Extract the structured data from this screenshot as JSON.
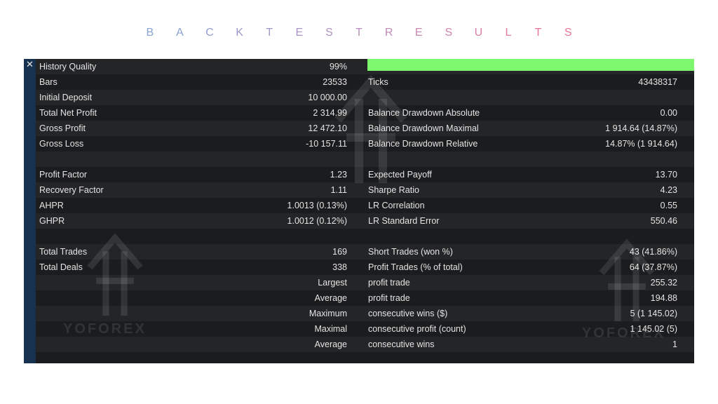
{
  "heading": {
    "letters": [
      {
        "ch": "B",
        "color": "#8aa3d4"
      },
      {
        "ch": "A",
        "color": "#8fa0d2"
      },
      {
        "ch": "C",
        "color": "#959dcf"
      },
      {
        "ch": "K",
        "color": "#9b9acb"
      },
      {
        "ch": "T",
        "color": "#a297c7"
      },
      {
        "ch": "E",
        "color": "#a994c3"
      },
      {
        "ch": "S",
        "color": "#b091bf"
      },
      {
        "ch": "T",
        "color": "#b88ebb"
      },
      {
        "ch": "R",
        "color": "#c08ab7"
      },
      {
        "ch": "E",
        "color": "#c887b2"
      },
      {
        "ch": "S",
        "color": "#cf83ac"
      },
      {
        "ch": "U",
        "color": "#d67fa6"
      },
      {
        "ch": "L",
        "color": "#dd7ba0"
      },
      {
        "ch": "T",
        "color": "#e3779a"
      },
      {
        "ch": "S",
        "color": "#e87394"
      }
    ]
  },
  "colors": {
    "panel_bg": "#1e1f21",
    "sidebar": "#16324f",
    "quality_bar": "#7ef86f",
    "text": "#e4e4e4"
  },
  "history_quality_fraction": 0.99,
  "rows": [
    {
      "lk": "History Quality",
      "lv": "99%",
      "rk": "",
      "rv": "",
      "bar": true
    },
    {
      "lk": "Bars",
      "lv": "23533",
      "rk": "Ticks",
      "rv": "43438317"
    },
    {
      "lk": "Initial Deposit",
      "lv": "10 000.00",
      "rk": "",
      "rv": ""
    },
    {
      "lk": "Total Net Profit",
      "lv": "2 314.99",
      "rk": "Balance Drawdown Absolute",
      "rv": "0.00"
    },
    {
      "lk": "Gross Profit",
      "lv": "12 472.10",
      "rk": "Balance Drawdown Maximal",
      "rv": "1 914.64 (14.87%)"
    },
    {
      "lk": "Gross Loss",
      "lv": "-10 157.11",
      "rk": "Balance Drawdown Relative",
      "rv": "14.87% (1 914.64)"
    },
    {
      "lk": "",
      "lv": "",
      "rk": "",
      "rv": ""
    },
    {
      "lk": "Profit Factor",
      "lv": "1.23",
      "rk": "Expected Payoff",
      "rv": "13.70"
    },
    {
      "lk": "Recovery Factor",
      "lv": "1.11",
      "rk": "Sharpe Ratio",
      "rv": "4.23"
    },
    {
      "lk": "AHPR",
      "lv": "1.0013 (0.13%)",
      "rk": "LR Correlation",
      "rv": "0.55"
    },
    {
      "lk": "GHPR",
      "lv": "1.0012 (0.12%)",
      "rk": "LR Standard Error",
      "rv": "550.46"
    },
    {
      "lk": "",
      "lv": "",
      "rk": "",
      "rv": ""
    },
    {
      "lk": "Total Trades",
      "lv": "169",
      "rk": "Short Trades (won %)",
      "rv": "43 (41.86%)"
    },
    {
      "lk": "Total Deals",
      "lv": "338",
      "rk": "Profit Trades (% of total)",
      "rv": "64 (37.87%)"
    },
    {
      "lk": "Largest",
      "lv": "",
      "rk": "profit trade",
      "rv": "255.32",
      "right": true
    },
    {
      "lk": "Average",
      "lv": "",
      "rk": "profit trade",
      "rv": "194.88",
      "right": true
    },
    {
      "lk": "Maximum",
      "lv": "",
      "rk": "consecutive wins ($)",
      "rv": "5 (1 145.02)",
      "right": true
    },
    {
      "lk": "Maximal",
      "lv": "",
      "rk": "consecutive profit (count)",
      "rv": "1 145.02 (5)",
      "right": true
    },
    {
      "lk": "Average",
      "lv": "",
      "rk": "consecutive wins",
      "rv": "1",
      "right": true
    },
    {
      "lk": "",
      "lv": "",
      "rk": "",
      "rv": ""
    }
  ],
  "watermarks": [
    {
      "text": "YOFOREX"
    },
    {
      "text": "YOFOREX"
    },
    {
      "text": "YOFOREX"
    }
  ],
  "icons": {
    "close": "close-icon",
    "watermark_logo": "arrow-logo-icon"
  }
}
